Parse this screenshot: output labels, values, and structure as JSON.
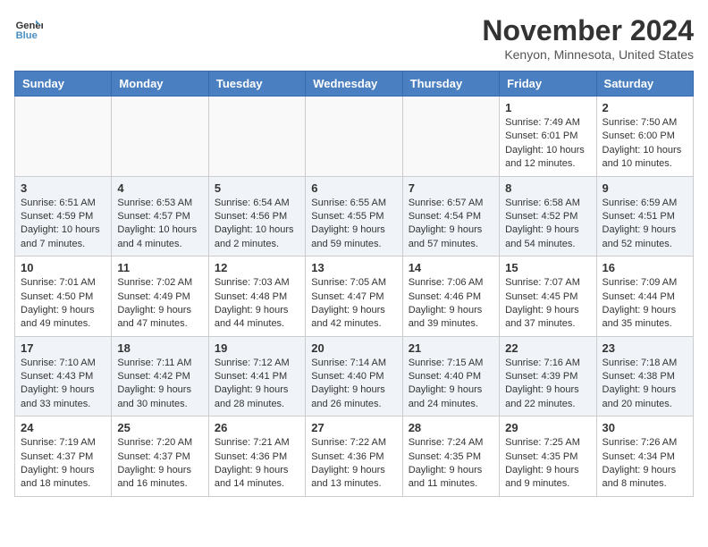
{
  "header": {
    "logo_line1": "General",
    "logo_line2": "Blue",
    "month_title": "November 2024",
    "location": "Kenyon, Minnesota, United States"
  },
  "weekdays": [
    "Sunday",
    "Monday",
    "Tuesday",
    "Wednesday",
    "Thursday",
    "Friday",
    "Saturday"
  ],
  "weeks": [
    [
      {
        "day": "",
        "info": ""
      },
      {
        "day": "",
        "info": ""
      },
      {
        "day": "",
        "info": ""
      },
      {
        "day": "",
        "info": ""
      },
      {
        "day": "",
        "info": ""
      },
      {
        "day": "1",
        "info": "Sunrise: 7:49 AM\nSunset: 6:01 PM\nDaylight: 10 hours and 12 minutes."
      },
      {
        "day": "2",
        "info": "Sunrise: 7:50 AM\nSunset: 6:00 PM\nDaylight: 10 hours and 10 minutes."
      }
    ],
    [
      {
        "day": "3",
        "info": "Sunrise: 6:51 AM\nSunset: 4:59 PM\nDaylight: 10 hours and 7 minutes."
      },
      {
        "day": "4",
        "info": "Sunrise: 6:53 AM\nSunset: 4:57 PM\nDaylight: 10 hours and 4 minutes."
      },
      {
        "day": "5",
        "info": "Sunrise: 6:54 AM\nSunset: 4:56 PM\nDaylight: 10 hours and 2 minutes."
      },
      {
        "day": "6",
        "info": "Sunrise: 6:55 AM\nSunset: 4:55 PM\nDaylight: 9 hours and 59 minutes."
      },
      {
        "day": "7",
        "info": "Sunrise: 6:57 AM\nSunset: 4:54 PM\nDaylight: 9 hours and 57 minutes."
      },
      {
        "day": "8",
        "info": "Sunrise: 6:58 AM\nSunset: 4:52 PM\nDaylight: 9 hours and 54 minutes."
      },
      {
        "day": "9",
        "info": "Sunrise: 6:59 AM\nSunset: 4:51 PM\nDaylight: 9 hours and 52 minutes."
      }
    ],
    [
      {
        "day": "10",
        "info": "Sunrise: 7:01 AM\nSunset: 4:50 PM\nDaylight: 9 hours and 49 minutes."
      },
      {
        "day": "11",
        "info": "Sunrise: 7:02 AM\nSunset: 4:49 PM\nDaylight: 9 hours and 47 minutes."
      },
      {
        "day": "12",
        "info": "Sunrise: 7:03 AM\nSunset: 4:48 PM\nDaylight: 9 hours and 44 minutes."
      },
      {
        "day": "13",
        "info": "Sunrise: 7:05 AM\nSunset: 4:47 PM\nDaylight: 9 hours and 42 minutes."
      },
      {
        "day": "14",
        "info": "Sunrise: 7:06 AM\nSunset: 4:46 PM\nDaylight: 9 hours and 39 minutes."
      },
      {
        "day": "15",
        "info": "Sunrise: 7:07 AM\nSunset: 4:45 PM\nDaylight: 9 hours and 37 minutes."
      },
      {
        "day": "16",
        "info": "Sunrise: 7:09 AM\nSunset: 4:44 PM\nDaylight: 9 hours and 35 minutes."
      }
    ],
    [
      {
        "day": "17",
        "info": "Sunrise: 7:10 AM\nSunset: 4:43 PM\nDaylight: 9 hours and 33 minutes."
      },
      {
        "day": "18",
        "info": "Sunrise: 7:11 AM\nSunset: 4:42 PM\nDaylight: 9 hours and 30 minutes."
      },
      {
        "day": "19",
        "info": "Sunrise: 7:12 AM\nSunset: 4:41 PM\nDaylight: 9 hours and 28 minutes."
      },
      {
        "day": "20",
        "info": "Sunrise: 7:14 AM\nSunset: 4:40 PM\nDaylight: 9 hours and 26 minutes."
      },
      {
        "day": "21",
        "info": "Sunrise: 7:15 AM\nSunset: 4:40 PM\nDaylight: 9 hours and 24 minutes."
      },
      {
        "day": "22",
        "info": "Sunrise: 7:16 AM\nSunset: 4:39 PM\nDaylight: 9 hours and 22 minutes."
      },
      {
        "day": "23",
        "info": "Sunrise: 7:18 AM\nSunset: 4:38 PM\nDaylight: 9 hours and 20 minutes."
      }
    ],
    [
      {
        "day": "24",
        "info": "Sunrise: 7:19 AM\nSunset: 4:37 PM\nDaylight: 9 hours and 18 minutes."
      },
      {
        "day": "25",
        "info": "Sunrise: 7:20 AM\nSunset: 4:37 PM\nDaylight: 9 hours and 16 minutes."
      },
      {
        "day": "26",
        "info": "Sunrise: 7:21 AM\nSunset: 4:36 PM\nDaylight: 9 hours and 14 minutes."
      },
      {
        "day": "27",
        "info": "Sunrise: 7:22 AM\nSunset: 4:36 PM\nDaylight: 9 hours and 13 minutes."
      },
      {
        "day": "28",
        "info": "Sunrise: 7:24 AM\nSunset: 4:35 PM\nDaylight: 9 hours and 11 minutes."
      },
      {
        "day": "29",
        "info": "Sunrise: 7:25 AM\nSunset: 4:35 PM\nDaylight: 9 hours and 9 minutes."
      },
      {
        "day": "30",
        "info": "Sunrise: 7:26 AM\nSunset: 4:34 PM\nDaylight: 9 hours and 8 minutes."
      }
    ]
  ]
}
